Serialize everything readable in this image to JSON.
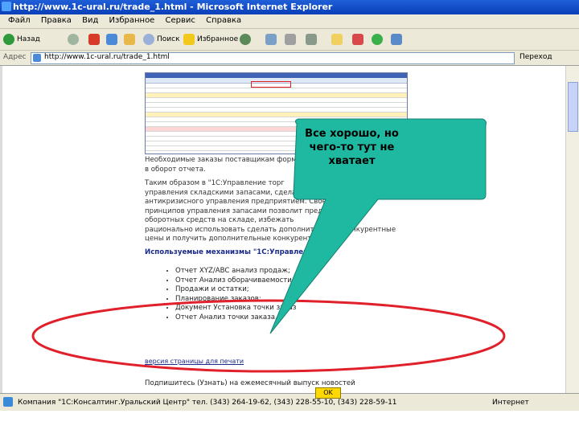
{
  "window": {
    "title": "http://www.1c-ural.ru/trade_1.html - Microsoft Internet Explorer"
  },
  "menubar": {
    "items": [
      "Файл",
      "Правка",
      "Вид",
      "Избранное",
      "Сервис",
      "Справка"
    ]
  },
  "toolbar": {
    "back_label": "Назад",
    "search_label": "Поиск",
    "favorites_label": "Избранное"
  },
  "address": {
    "label": "Адрес",
    "url": "http://www.1c-ural.ru/trade_1.html",
    "go_label": "Переход"
  },
  "page": {
    "paragraph1": [
      "Необходимые заказы поставщикам форм",
      "в оборот отчета."
    ],
    "paragraph2": [
      "Таким образом в \"1С:Управление торг",
      "управления складскими запасами, сделан",
      "антикризисного управления предприятием. Своевр",
      "принципов управления запасами позволит пред",
      "оборотных средств на складе, избежать",
      "рационально использовать сделать дополнительные конкурентные",
      "цены и получить дополнительные конкурентные"
    ],
    "mechanisms_heading": "Используемые механизмы \"1С:Управление",
    "mechanisms": [
      "Отчет XYZ/ABC анализ продаж;",
      "Отчет Анализ оборачиваемости тов",
      "Продажи и остатки;",
      "Планирование заказов;",
      "Документ Установка точки заказ",
      "Отчет Анализ точки заказа."
    ],
    "print_link": "версия страницы для печати",
    "footer_line": "Подпишитесь (Узнать) на ежемесячный выпуск новостей"
  },
  "callout": {
    "text": "Все хорошо, но чего-то тут не хватает"
  },
  "statusbar": {
    "company": "Компания \"1С:Консалтинг.Уральский Центр\" тел. (343) 264-19-62, (343) 228-55-10, (343) 228-59-11",
    "ok_label": "OK",
    "zone": "Интернет"
  },
  "colors": {
    "callout_fill": "#1fb8a0",
    "ellipse_stroke": "#e0202a",
    "titlebar": "#0a3fb8"
  }
}
